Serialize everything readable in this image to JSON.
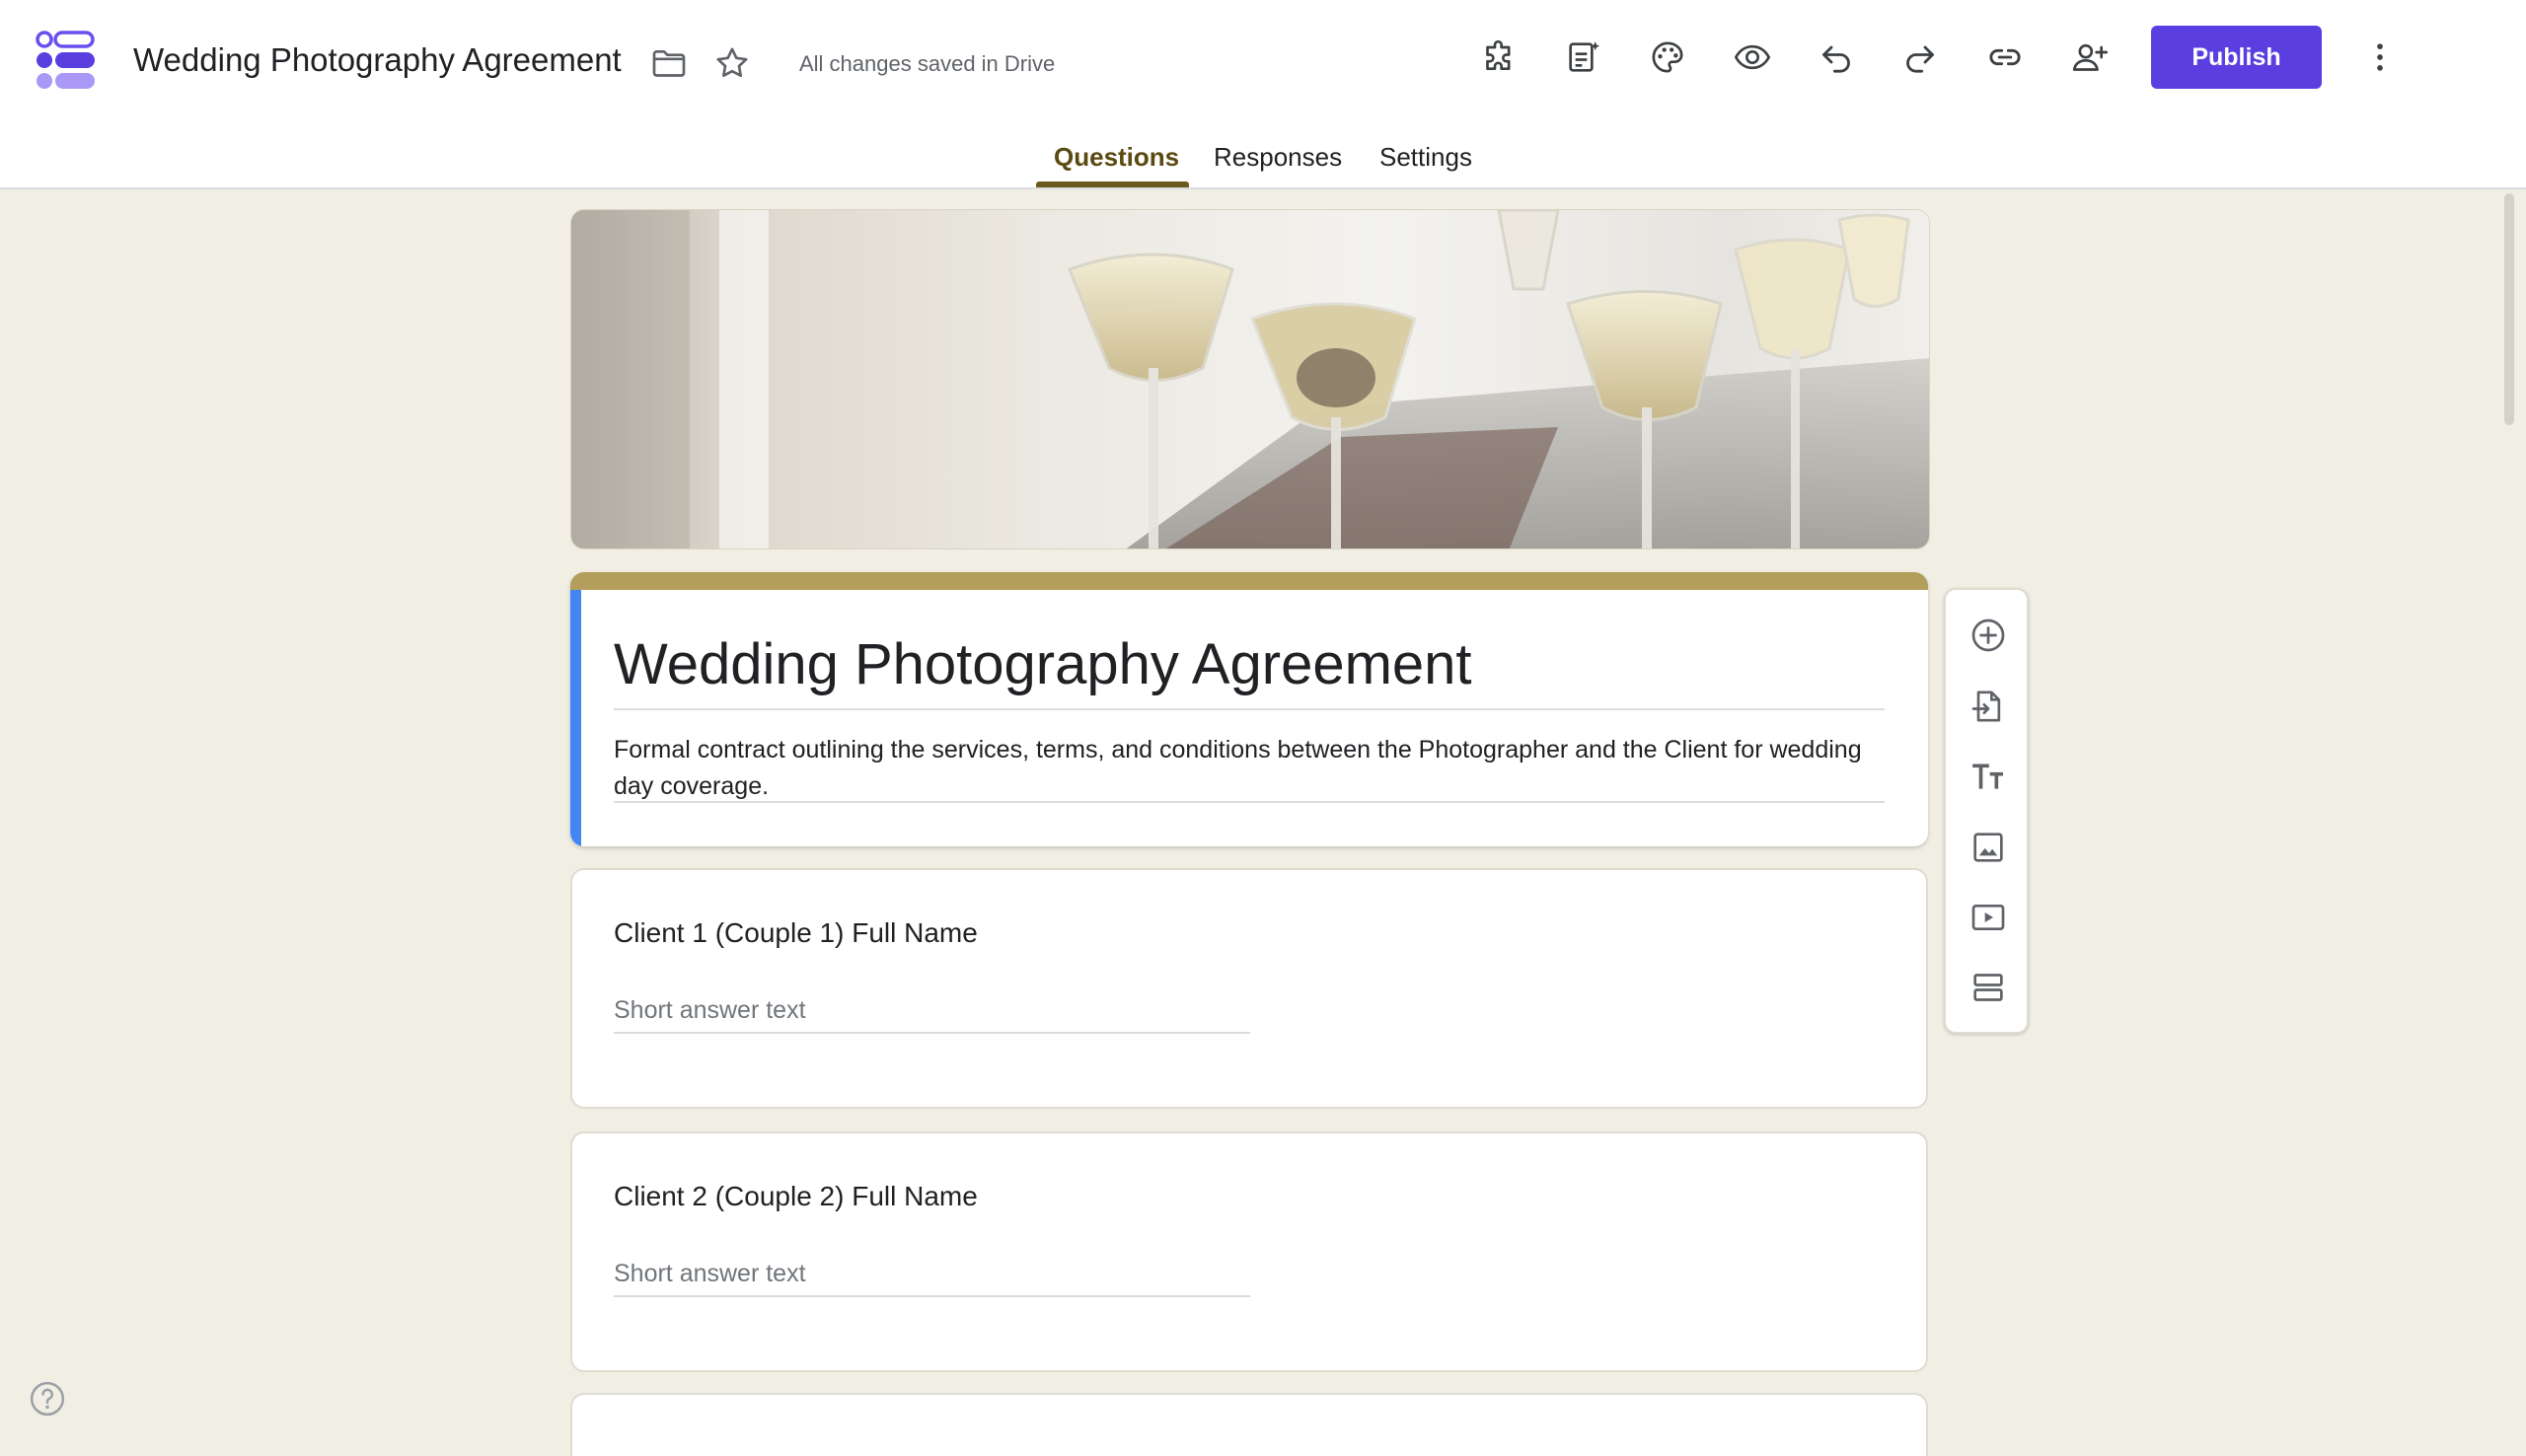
{
  "app": {
    "doc_title": "Wedding Photography Agreement",
    "save_status": "All changes saved in Drive",
    "publish_label": "Publish",
    "accent_color": "#5b3ee0",
    "theme_color": "#b39f5b",
    "icons": {
      "logo": "forms-logo-icon",
      "folder": "folder-icon",
      "star": "star-icon",
      "addons": "puzzle-icon",
      "ai_summary": "sparkle-document-icon",
      "theme": "palette-icon",
      "preview": "eye-icon",
      "undo": "undo-icon",
      "redo": "redo-icon",
      "link": "link-icon",
      "collaborators": "add-person-icon",
      "more": "more-vertical-icon"
    }
  },
  "tabs": [
    {
      "label": "Questions",
      "active": true
    },
    {
      "label": "Responses",
      "active": false
    },
    {
      "label": "Settings",
      "active": false
    }
  ],
  "form": {
    "title": "Wedding Photography Agreement",
    "description": "Formal contract outlining the services, terms, and conditions between the Photographer and the Client for wedding day coverage."
  },
  "questions": [
    {
      "title": "Client 1 (Couple 1) Full Name",
      "placeholder": "Short answer text"
    },
    {
      "title": "Client 2 (Couple 2) Full Name",
      "placeholder": "Short answer text"
    }
  ],
  "toolbar": {
    "items": [
      {
        "icon": "add-circle-icon"
      },
      {
        "icon": "import-questions-icon"
      },
      {
        "icon": "title-text-icon"
      },
      {
        "icon": "image-icon"
      },
      {
        "icon": "video-icon"
      },
      {
        "icon": "section-icon"
      }
    ]
  }
}
